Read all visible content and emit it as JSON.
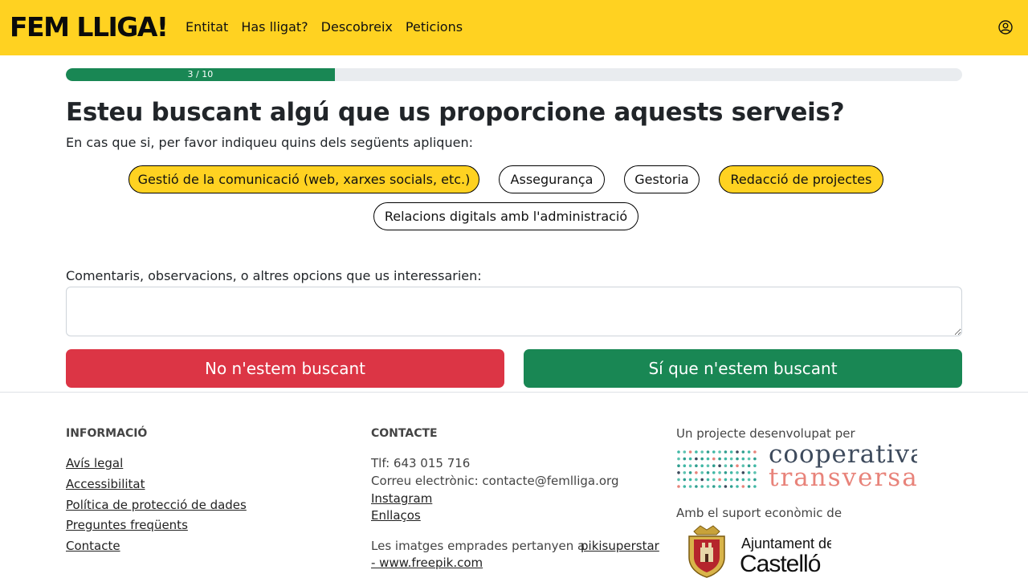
{
  "header": {
    "brand": "FEM LLIGA!",
    "nav": [
      "Entitat",
      "Has lligat?",
      "Descobreix",
      "Peticions"
    ],
    "user_icon": "user-circle-icon"
  },
  "progress": {
    "label": "3 / 10",
    "current": 3,
    "total": 10,
    "fill_color": "#198754"
  },
  "question": {
    "title": "Esteu buscant algú que us proporcione aquests serveis?",
    "hint": "En cas que si, per favor indiqueu quins dels següents apliquen:"
  },
  "options": [
    {
      "label": "Gestió de la comunicació (web, xarxes socials, etc.)",
      "selected": true
    },
    {
      "label": "Assegurança",
      "selected": false
    },
    {
      "label": "Gestoria",
      "selected": false
    },
    {
      "label": "Redacció de projectes",
      "selected": true
    },
    {
      "label": "Relacions digitals amb l'administració",
      "selected": false
    }
  ],
  "comments": {
    "label": "Comentaris, observacions, o altres opcions que us interessarien:",
    "value": ""
  },
  "actions": {
    "no_label": "No n'estem buscant",
    "yes_label": "Sí que n'estem buscant"
  },
  "footer": {
    "info": {
      "heading": "INFORMACIÓ",
      "links": [
        "Avís legal",
        "Accessibilitat",
        "Política de protecció de dades",
        "Preguntes freqüents",
        "Contacte"
      ]
    },
    "contact": {
      "heading": "CONTACTE",
      "phone": "Tlf: 643 015 716",
      "email": "Correu electrònic: contacte@femlliga.org",
      "instagram": "Instagram",
      "links": "Enllaços",
      "credits_prefix": "Les imatges emprades pertanyen a",
      "credits_link_1": "pikisuperstar",
      "credits_link_2": "- www.freepik.com"
    },
    "project": {
      "developed_by": "Un projecte desenvolupat per",
      "coop_name_1": "cooperativa",
      "coop_name_2": "transversal",
      "support": "Amb el suport econòmic de",
      "council_1": "Ajuntament de",
      "council_2": "Castelló"
    }
  },
  "colors": {
    "brand_yellow": "#ffd221",
    "danger": "#dc3545",
    "success": "#198754"
  }
}
